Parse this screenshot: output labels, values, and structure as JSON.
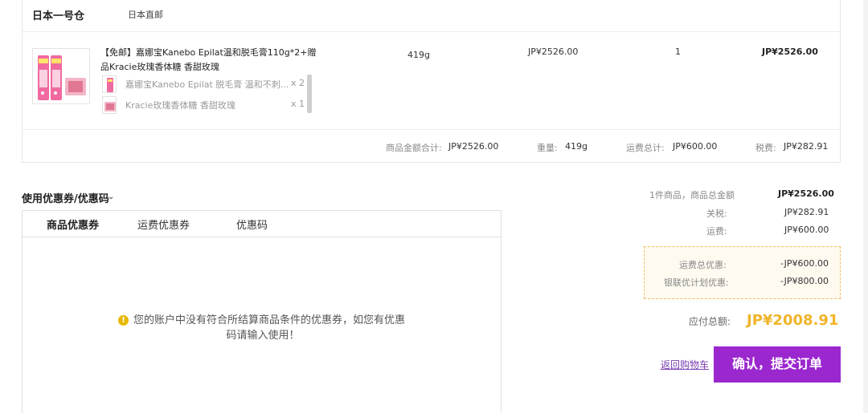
{
  "warehouse": {
    "name": "日本一号仓",
    "type": "日本直邮"
  },
  "product": {
    "title": "【免邮】嘉娜宝Kanebo Epilat温和脱毛膏110g*2+赠品Kracie玫瑰香体糖 香甜玫瑰",
    "weight": "419g",
    "price": "JP¥2526.00",
    "quantity": "1",
    "subtotal": "JP¥2526.00",
    "items": [
      {
        "name": "嘉娜宝Kanebo Epilat 脱毛膏 温和不刺...",
        "qty": "x 2"
      },
      {
        "name": "Kracie玫瑰香体糖 香甜玫瑰",
        "qty": "x 1"
      }
    ]
  },
  "summary": {
    "goods_total_label": "商品金额合计:",
    "goods_total": "JP¥2526.00",
    "weight_label": "重量:",
    "weight": "419g",
    "shipping_label": "运费总计:",
    "shipping": "JP¥600.00",
    "tax_label": "税费:",
    "tax": "JP¥282.91"
  },
  "coupon": {
    "title": "使用优惠券/优惠码",
    "tabs": [
      "商品优惠券",
      "运费优惠券",
      "优惠码"
    ],
    "active_tab": 0,
    "notice_icon": "!",
    "notice": "您的账户中没有符合所结算商品条件的优惠券，如您有优惠码请输入使用！"
  },
  "totals": {
    "items_label": "1件商品，商品总金额",
    "items_value": "JP¥2526.00",
    "duty_label": "关税:",
    "duty_value": "JP¥282.91",
    "freight_label": "运费:",
    "freight_value": "JP¥600.00",
    "freight_discount_label": "运费总优惠:",
    "freight_discount_value": "-JP¥600.00",
    "unionpay_label": "银联优计划优惠:",
    "unionpay_value": "-JP¥800.00",
    "payable_label": "应付总额:",
    "payable_value": "JP¥2008.91"
  },
  "actions": {
    "back_label": "返回购物车",
    "submit_label": "确认，提交订单"
  },
  "colors": {
    "accent": "#9b27cf",
    "payable": "#f0b429",
    "notice_icon": "#e8b800",
    "discount_border": "#f0c060"
  }
}
